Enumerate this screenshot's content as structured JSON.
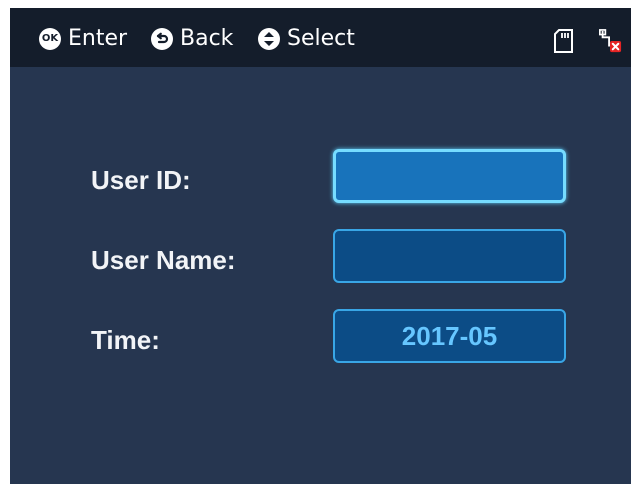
{
  "topbar": {
    "hints": [
      {
        "button": "OK",
        "label": "Enter",
        "icon": "ok-button-icon"
      },
      {
        "label": "Back",
        "icon": "back-button-icon"
      },
      {
        "label": "Select",
        "icon": "up-down-button-icon"
      }
    ],
    "status_icons": [
      "sd-card-icon",
      "network-disconnected-icon"
    ]
  },
  "form": {
    "user_id": {
      "label": "User ID:",
      "value": ""
    },
    "user_name": {
      "label": "User Name:",
      "value": ""
    },
    "time": {
      "label": "Time:",
      "value": "2017-05"
    }
  },
  "colors": {
    "background": "#263650",
    "topbar": "#141d2b",
    "field": "#0c4c86",
    "field_active": "#1873bb",
    "field_border": "#39a6e6",
    "value_text": "#66c6ff"
  }
}
